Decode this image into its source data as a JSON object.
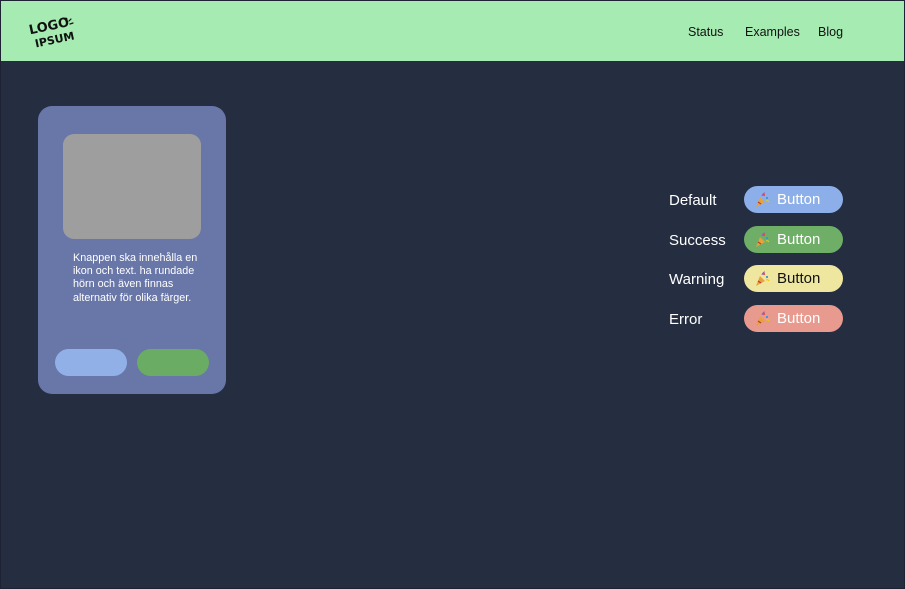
{
  "header": {
    "logo": {
      "line1": "LOGO",
      "line2": "IPSUM",
      "icon": "logo-icon"
    },
    "nav": [
      {
        "label": "Status"
      },
      {
        "label": "Examples"
      },
      {
        "label": "Blog"
      }
    ]
  },
  "card": {
    "image": "image-placeholder",
    "text": "Knappen ska innehålla en ikon och text. ha rundade hörn och även finnas alternativ för olika färger.",
    "buttons": [
      {
        "color": "#92b0e8",
        "label": ""
      },
      {
        "color": "#6aac64",
        "label": ""
      }
    ]
  },
  "variants": [
    {
      "label": "Default",
      "button_label": "Button",
      "icon": "party-popper-icon",
      "color": "#8dafe9",
      "text_color": "#ffffff"
    },
    {
      "label": "Success",
      "button_label": "Button",
      "icon": "party-popper-icon",
      "color": "#6fae67",
      "text_color": "#ffffff"
    },
    {
      "label": "Warning",
      "button_label": "Button",
      "icon": "party-popper-icon",
      "color": "#efe6a0",
      "text_color": "#111111"
    },
    {
      "label": "Error",
      "button_label": "Button",
      "icon": "party-popper-icon",
      "color": "#e89a8f",
      "text_color": "#ffffff"
    }
  ],
  "colors": {
    "background": "#252d40",
    "header": "#a6ecb2",
    "card": "#6876a8",
    "image_placeholder": "#9e9e9f"
  }
}
